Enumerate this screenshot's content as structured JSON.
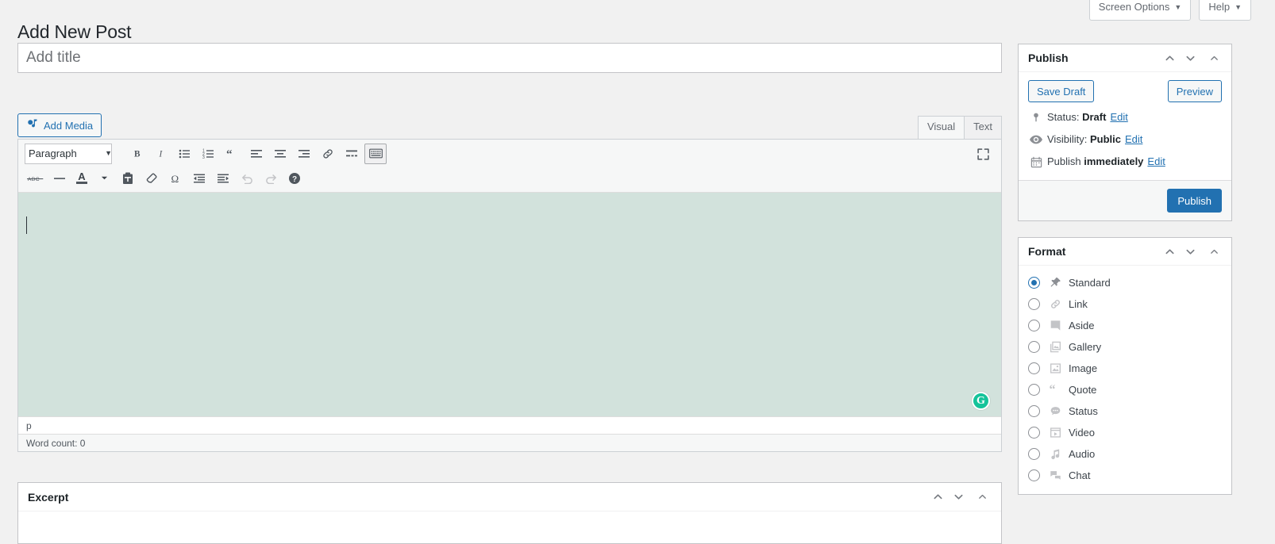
{
  "screen_meta": {
    "screen_options_label": "Screen Options",
    "help_label": "Help",
    "caret": "▼"
  },
  "page": {
    "title": "Add New Post"
  },
  "title_field": {
    "placeholder": "Add title",
    "value": ""
  },
  "media": {
    "add_media_label": "Add Media"
  },
  "editor_tabs": [
    {
      "label": "Visual",
      "active": true
    },
    {
      "label": "Text",
      "active": false
    }
  ],
  "toolbar": {
    "paragraph_select": "Paragraph",
    "row1": [
      {
        "name": "bold",
        "title": "Bold"
      },
      {
        "name": "italic",
        "title": "Italic"
      },
      {
        "name": "bulleted-list",
        "title": "Bulleted list"
      },
      {
        "name": "numbered-list",
        "title": "Numbered list"
      },
      {
        "name": "blockquote",
        "title": "Blockquote"
      },
      {
        "name": "align-left",
        "title": "Align left"
      },
      {
        "name": "align-center",
        "title": "Align center"
      },
      {
        "name": "align-right",
        "title": "Align right"
      },
      {
        "name": "insert-link",
        "title": "Insert/edit link"
      },
      {
        "name": "read-more",
        "title": "Insert Read More tag"
      },
      {
        "name": "toolbar-toggle",
        "title": "Toolbar Toggle"
      }
    ],
    "row2": [
      {
        "name": "strikethrough",
        "title": "Strikethrough"
      },
      {
        "name": "horizontal-line",
        "title": "Horizontal line"
      },
      {
        "name": "text-color",
        "title": "Text color"
      },
      {
        "name": "paste-as-text",
        "title": "Paste as text"
      },
      {
        "name": "clear-formatting",
        "title": "Clear formatting"
      },
      {
        "name": "special-character",
        "title": "Special character"
      },
      {
        "name": "decrease-indent",
        "title": "Decrease indent"
      },
      {
        "name": "increase-indent",
        "title": "Increase indent"
      },
      {
        "name": "undo",
        "title": "Undo"
      },
      {
        "name": "redo",
        "title": "Redo"
      },
      {
        "name": "keyboard-shortcuts",
        "title": "Keyboard Shortcuts"
      }
    ],
    "fullscreen_title": "Distraction-free writing mode"
  },
  "editor": {
    "content": "",
    "background_color": "#d2e2dc",
    "path": "p",
    "word_count_label": "Word count: 0",
    "grammarly_letter": "G",
    "grammarly_color": "#15c39a"
  },
  "excerpt": {
    "title": "Excerpt"
  },
  "publish": {
    "title": "Publish",
    "save_draft_label": "Save Draft",
    "preview_label": "Preview",
    "publish_label": "Publish",
    "status_label": "Status:",
    "status_value": "Draft",
    "visibility_label": "Visibility:",
    "visibility_value": "Public",
    "schedule_label": "Publish",
    "schedule_value": "immediately",
    "edit_label": "Edit"
  },
  "format": {
    "title": "Format",
    "options": [
      {
        "label": "Standard",
        "icon": "pin-icon",
        "selected": true
      },
      {
        "label": "Link",
        "icon": "link-icon",
        "selected": false
      },
      {
        "label": "Aside",
        "icon": "aside-icon",
        "selected": false
      },
      {
        "label": "Gallery",
        "icon": "gallery-icon",
        "selected": false
      },
      {
        "label": "Image",
        "icon": "image-icon",
        "selected": false
      },
      {
        "label": "Quote",
        "icon": "quote-icon",
        "selected": false
      },
      {
        "label": "Status",
        "icon": "status-icon",
        "selected": false
      },
      {
        "label": "Video",
        "icon": "video-icon",
        "selected": false
      },
      {
        "label": "Audio",
        "icon": "audio-icon",
        "selected": false
      },
      {
        "label": "Chat",
        "icon": "chat-icon",
        "selected": false
      }
    ]
  },
  "colors": {
    "accent": "#2271b1",
    "editor_bg": "#d2e2dc",
    "page_bg": "#f1f1f1"
  }
}
